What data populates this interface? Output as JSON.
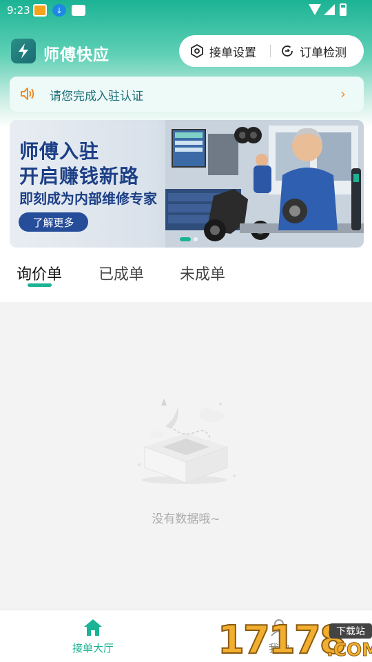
{
  "status_bar": {
    "time": "9:23",
    "icons": [
      "notification-app-icon",
      "download-icon",
      "notification-thumb-icon",
      "wifi-icon",
      "signal-icon",
      "battery-icon"
    ]
  },
  "header": {
    "title": "师傅快应",
    "logo_icon": "lightning-logo-icon",
    "actions": [
      {
        "label": "接单设置",
        "icon": "settings-hexagon-icon"
      },
      {
        "label": "订单检测",
        "icon": "order-check-icon"
      }
    ]
  },
  "notice": {
    "text": "请您完成入驻认证",
    "icon": "speaker-icon",
    "arrow_icon": "chevron-right-icon"
  },
  "banner": {
    "line1": "师傅入驻",
    "line2": "开启赚钱新路",
    "subtitle": "即刻成为内部维修专家",
    "button": "了解更多",
    "page_index": 0,
    "page_count": 2
  },
  "tabs": {
    "items": [
      "询价单",
      "已成单",
      "未成单"
    ],
    "active": 0
  },
  "empty_state": {
    "text": "没有数据哦~",
    "icon": "empty-box-icon"
  },
  "bottom_nav": {
    "items": [
      {
        "label": "接单大厅",
        "icon": "home-icon",
        "active": true
      },
      {
        "label": "我的",
        "icon": "user-icon",
        "active": false
      }
    ]
  },
  "watermark": {
    "number": "17178",
    "badge": "下载站",
    "domain": ".COM"
  },
  "colors": {
    "accent": "#1bb394",
    "banner_text": "#1c3f86",
    "notice_text": "#1a6e7a",
    "notice_icon": "#f08a2a"
  }
}
